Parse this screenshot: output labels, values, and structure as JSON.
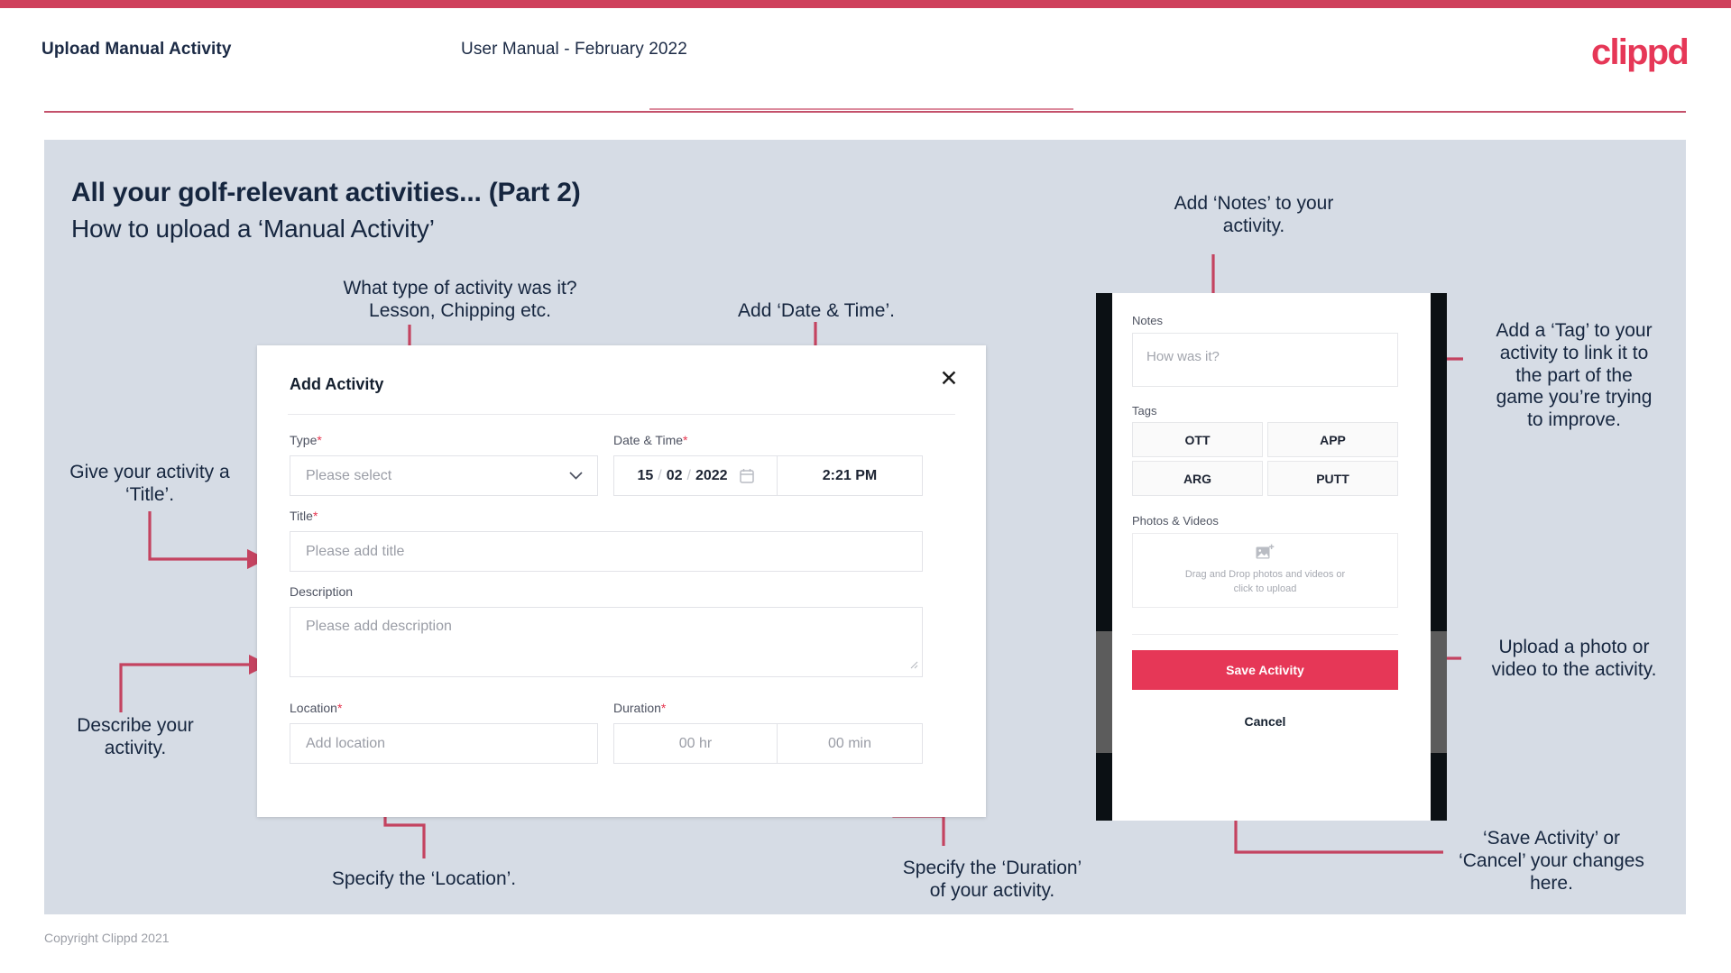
{
  "header": {
    "title": "Upload Manual Activity",
    "subtitle": "User Manual - February 2022",
    "logo": "clippd"
  },
  "slide": {
    "title": "All your golf-relevant activities... (Part 2)",
    "subtitle": "How to upload a ‘Manual Activity’"
  },
  "annotations": {
    "type": "What type of activity was it?\nLesson, Chipping etc.",
    "datetime": "Add ‘Date & Time’.",
    "title": "Give your activity a\n‘Title’.",
    "describe": "Describe your\nactivity.",
    "location": "Specify the ‘Location’.",
    "duration": "Specify the ‘Duration’\nof your activity.",
    "notes": "Add ‘Notes’ to your\nactivity.",
    "tag": "Add a ‘Tag’ to your\nactivity to link it to\nthe part of the\ngame you’re trying\nto improve.",
    "upload": "Upload a photo or\nvideo to the activity.",
    "save": "‘Save Activity’ or\n‘Cancel’ your changes\nhere."
  },
  "modal": {
    "title": "Add Activity",
    "close_icon": "close-icon",
    "fields": {
      "type": {
        "label": "Type",
        "required": "*",
        "placeholder": "Please select"
      },
      "datetime": {
        "label": "Date & Time",
        "required": "*",
        "day": "15",
        "sep1": "/",
        "month": "02",
        "sep2": "/",
        "year": "2022",
        "time": "2:21 PM"
      },
      "title": {
        "label": "Title",
        "required": "*",
        "placeholder": "Please add title"
      },
      "description": {
        "label": "Description",
        "required": "",
        "placeholder": "Please add description"
      },
      "location": {
        "label": "Location",
        "required": "*",
        "placeholder": "Add location"
      },
      "duration": {
        "label": "Duration",
        "required": "*",
        "hours": "00 hr",
        "minutes": "00 min"
      }
    }
  },
  "mobile": {
    "notes": {
      "label": "Notes",
      "placeholder": "How was it?"
    },
    "tags": {
      "label": "Tags",
      "items": [
        "OTT",
        "APP",
        "ARG",
        "PUTT"
      ]
    },
    "photos": {
      "label": "Photos & Videos",
      "dropzone_line1": "Drag and Drop photos and videos or",
      "dropzone_line2": "click to upload"
    },
    "save_label": "Save Activity",
    "cancel_label": "Cancel"
  },
  "footer": {
    "copyright": "Copyright Clippd 2021"
  },
  "colors": {
    "accent": "#e63757",
    "strip": "#cf405c",
    "slide_bg": "#d6dce5",
    "text_dark": "#16263f",
    "connector": "#c44360"
  }
}
